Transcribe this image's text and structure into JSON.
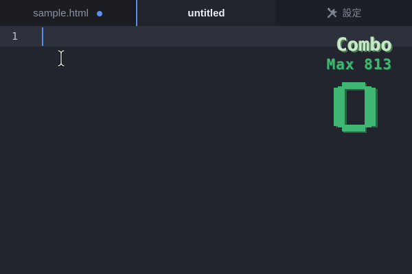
{
  "tabs": [
    {
      "label": "sample.html",
      "modified": true
    },
    {
      "label": "untitled",
      "active": true
    },
    {
      "label": "設定",
      "icon": "tools-icon"
    }
  ],
  "editor": {
    "line_numbers": [
      "1"
    ],
    "content": ""
  },
  "combo": {
    "title": "Combo",
    "max_label": "Max 813",
    "count": "0",
    "color": "#3fb772"
  },
  "colors": {
    "accent": "#5a8fe4",
    "modified_dot": "#5b8ff0",
    "background": "#22252d"
  }
}
